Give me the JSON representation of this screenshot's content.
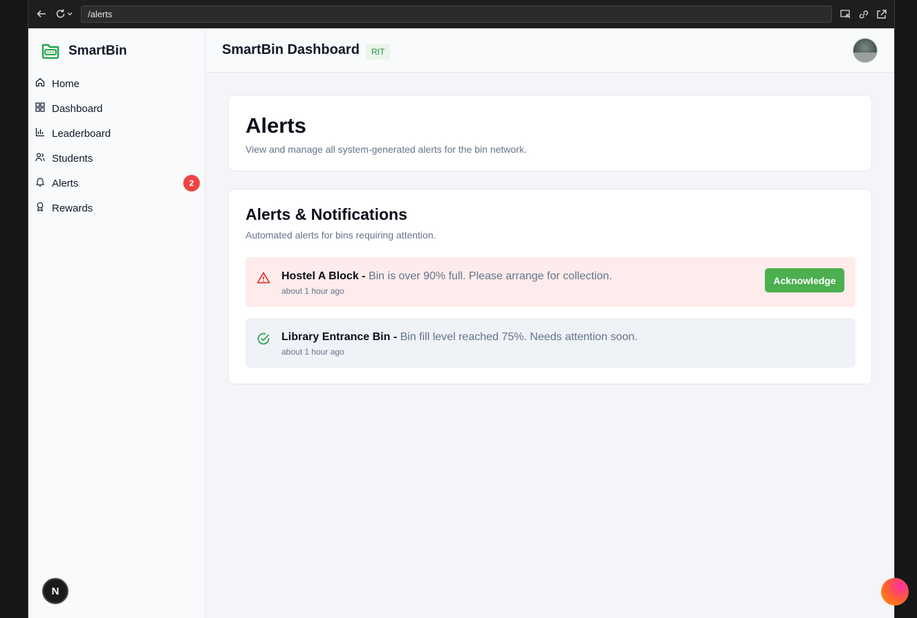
{
  "browser": {
    "url": "/alerts"
  },
  "sidebar": {
    "brand": "SmartBin",
    "items": [
      {
        "label": "Home",
        "icon": "home-icon"
      },
      {
        "label": "Dashboard",
        "icon": "dashboard-grid-icon"
      },
      {
        "label": "Leaderboard",
        "icon": "bar-chart-icon"
      },
      {
        "label": "Students",
        "icon": "users-icon"
      },
      {
        "label": "Alerts",
        "icon": "bell-icon",
        "badge": "2"
      },
      {
        "label": "Rewards",
        "icon": "award-icon"
      }
    ]
  },
  "header": {
    "title": "SmartBin Dashboard",
    "org_badge": "RIT"
  },
  "page": {
    "title": "Alerts",
    "subtitle": "View and manage all system-generated alerts for the bin network."
  },
  "alerts_card": {
    "title": "Alerts & Notifications",
    "subtitle": "Automated alerts for bins requiring attention.",
    "alerts": [
      {
        "source": "Hostel A Block -",
        "message": "Bin is over 90% full. Please arrange for collection.",
        "time": "about 1 hour ago",
        "status": "warning",
        "action": "Acknowledge"
      },
      {
        "source": "Library Entrance Bin -",
        "message": "Bin fill level reached 75%. Needs attention soon.",
        "time": "about 1 hour ago",
        "status": "acknowledged"
      }
    ]
  },
  "colors": {
    "brand_green": "#4caf50",
    "badge_red": "#ef4444",
    "alert_red_bg": "#fdeceb",
    "alert_grey_bg": "#eff2f6"
  }
}
